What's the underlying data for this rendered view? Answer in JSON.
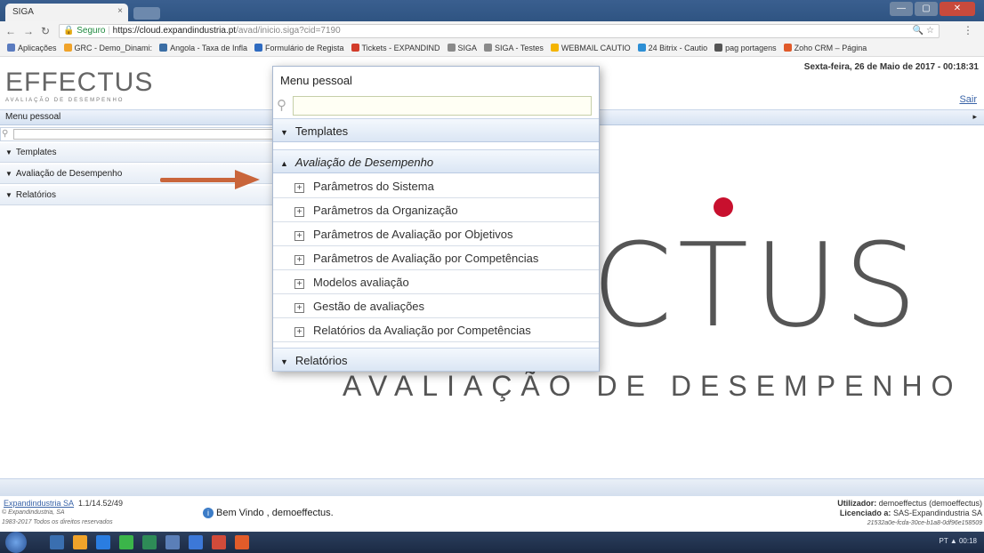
{
  "browser": {
    "tab_title": "SIGA",
    "tab_close": "×",
    "window_buttons": [
      "—",
      "▢",
      "✕"
    ],
    "address": {
      "secure_label": "Seguro",
      "host": "https://cloud.expandindustria.pt",
      "path": "/avad/inicio.siga?cid=7190"
    },
    "bookmarks": [
      {
        "label": "Aplicações",
        "color": "#5a7bbf"
      },
      {
        "label": "GRC - Demo_Dinami:",
        "color": "#f0a32a"
      },
      {
        "label": "Angola - Taxa de Infla",
        "color": "#3b6ea5"
      },
      {
        "label": "Formulário de Regista",
        "color": "#2f6bc0"
      },
      {
        "label": "Tickets - EXPANDIND",
        "color": "#d23c2a"
      },
      {
        "label": "SIGA",
        "color": "#8a8a8a"
      },
      {
        "label": "SIGA - Testes",
        "color": "#8a8a8a"
      },
      {
        "label": "WEBMAIL CAUTIO",
        "color": "#f4b400"
      },
      {
        "label": "24 Bitrix - Cautio",
        "color": "#2d8fd5"
      },
      {
        "label": "pag portagens",
        "color": "#555555"
      },
      {
        "label": "Zoho CRM – Página",
        "color": "#e05a2a"
      }
    ]
  },
  "header": {
    "logo_word": "EFFECTUS",
    "logo_sub": "AVALIAÇÃO DE DESEMPENHO",
    "datetime": "Sexta-feira, 26 de Maio de 2017 - 00:18:31",
    "logout": "Sair"
  },
  "sidebar": {
    "title": "Menu pessoal",
    "collapse_glyph": "▸",
    "items": [
      {
        "label": "Templates"
      },
      {
        "label": "Avaliação de Desempenho"
      },
      {
        "label": "Relatórios"
      }
    ]
  },
  "background_logo": {
    "word": "CTUS",
    "sub": "AVALIAÇÃO DE DESEMPENHO",
    "accent": "#c8102e"
  },
  "popup": {
    "title": "Menu pessoal",
    "sections": [
      {
        "label": "Templates",
        "state": "collapsed"
      },
      {
        "label": "Avaliação de Desempenho",
        "state": "expanded"
      },
      {
        "label": "Relatórios",
        "state": "collapsed"
      }
    ],
    "items": [
      "Parâmetros do Sistema",
      "Parâmetros da Organização",
      "Parâmetros de Avaliação por Objetivos",
      "Parâmetros de Avaliação por Competências",
      "Modelos avaliação",
      "Gestão de avaliações",
      "Relatórios da Avaliação por Competências"
    ]
  },
  "footer": {
    "company_link": "Expandindustria SA",
    "version": "1.1/14.52/49",
    "copyright1": "© Expandindustria, SA",
    "copyright2": "1983-2017 Todos os direitos reservados",
    "welcome": "Bem Vindo , demoeffectus.",
    "user_label": "Utilizador:",
    "user_value": "demoeffectus (demoeffectus)",
    "license_label": "Licenciado a:",
    "license_value": "SAS-Expandindustria SA",
    "license_hash": "21532a0e-fcda-30ce-b1a8-0df96e158509"
  },
  "taskbar": {
    "tray_text": "PT  ▲  00:18",
    "icons": [
      "#3a6fb0",
      "#f0a32a",
      "#2a7de1",
      "#3bb54a",
      "#2e8b57",
      "#5b7fb8",
      "#3c78d8",
      "#d24b3a",
      "#e25c2a"
    ]
  }
}
